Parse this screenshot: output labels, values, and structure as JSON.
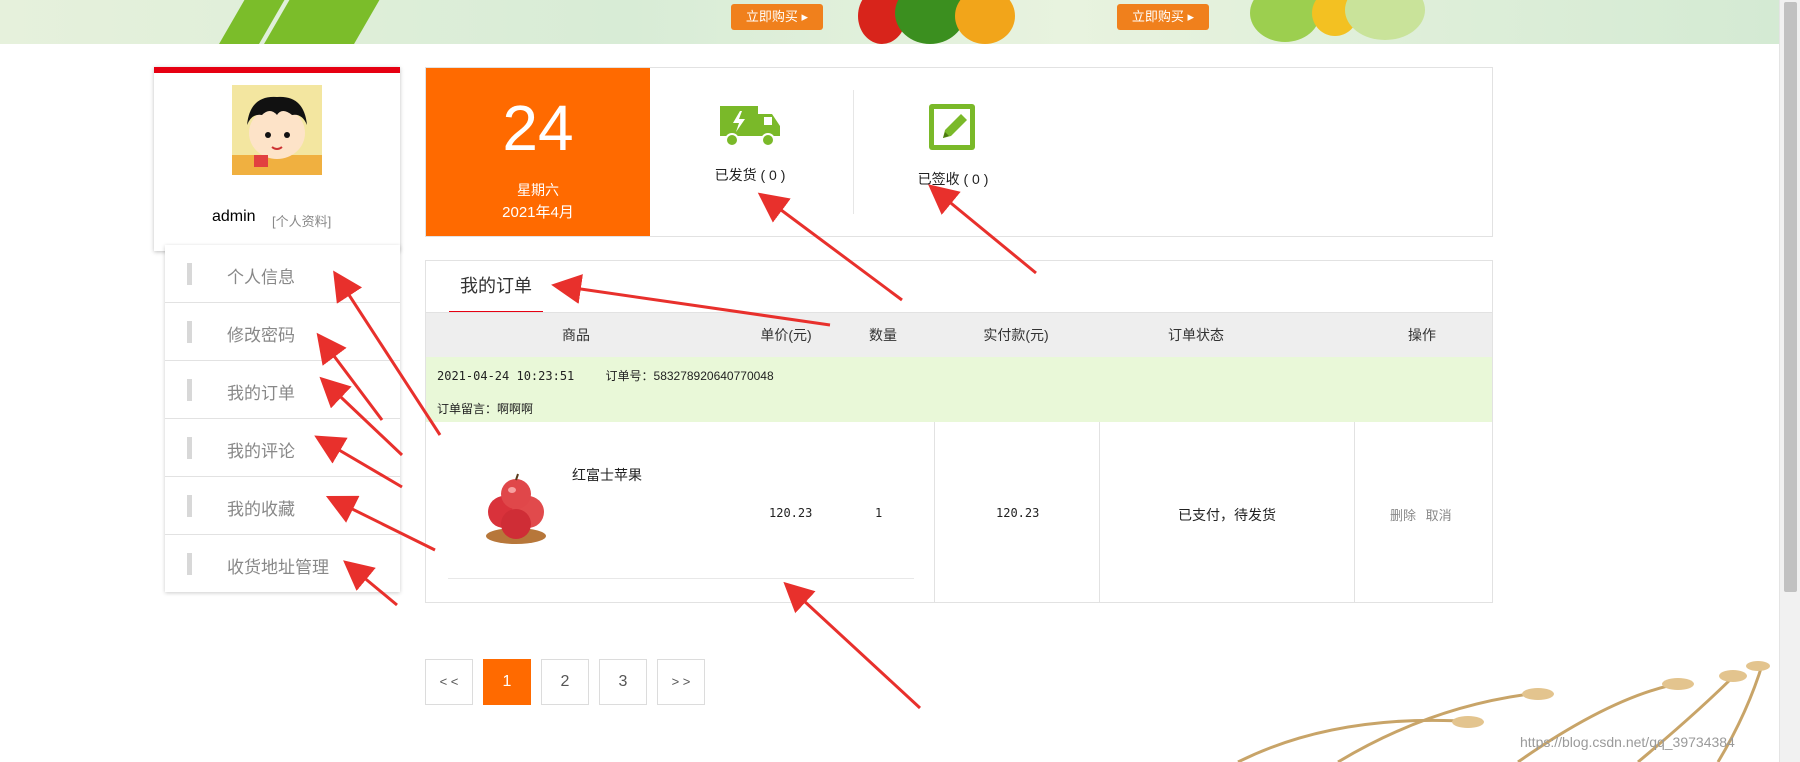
{
  "banner": {
    "buy_button_1": "立即购买 ▸",
    "buy_button_2": "立即购买 ▸"
  },
  "profile": {
    "username": "admin",
    "profile_link": "[个人资料]"
  },
  "menu": {
    "items": [
      {
        "label": "个人信息"
      },
      {
        "label": "修改密码"
      },
      {
        "label": "我的订单"
      },
      {
        "label": "我的评论"
      },
      {
        "label": "我的收藏"
      },
      {
        "label": "收货地址管理"
      }
    ]
  },
  "date": {
    "day": "24",
    "weekday": "星期六",
    "year_month": "2021年4月"
  },
  "stats": {
    "shipped": "已发货 ( 0 )",
    "signed": "已签收 ( 0 )"
  },
  "orders": {
    "tab_label": "我的订单",
    "columns": [
      "商品",
      "单价(元)",
      "数量",
      "实付款(元)",
      "订单状态",
      "操作"
    ],
    "order": {
      "datetime": "2021-04-24 10:23:51",
      "order_no": "订单号：583278920640770048",
      "note": "订单留言：啊啊啊",
      "product_name": "红富士苹果",
      "unit_price": "120.23",
      "quantity": "1",
      "paid": "120.23",
      "status": "已支付，待发货",
      "op_delete": "删除",
      "op_cancel": "取消"
    }
  },
  "pagination": {
    "prev": "< <",
    "pages": [
      "1",
      "2",
      "3"
    ],
    "next": "> >",
    "current": "1"
  },
  "watermark": "https://blog.csdn.net/qq_39734384",
  "colors": {
    "accent_orange": "#ff6a00",
    "accent_red": "#e60012",
    "icon_green": "#7ab929",
    "order_info_bg": "#e9f8d8"
  }
}
